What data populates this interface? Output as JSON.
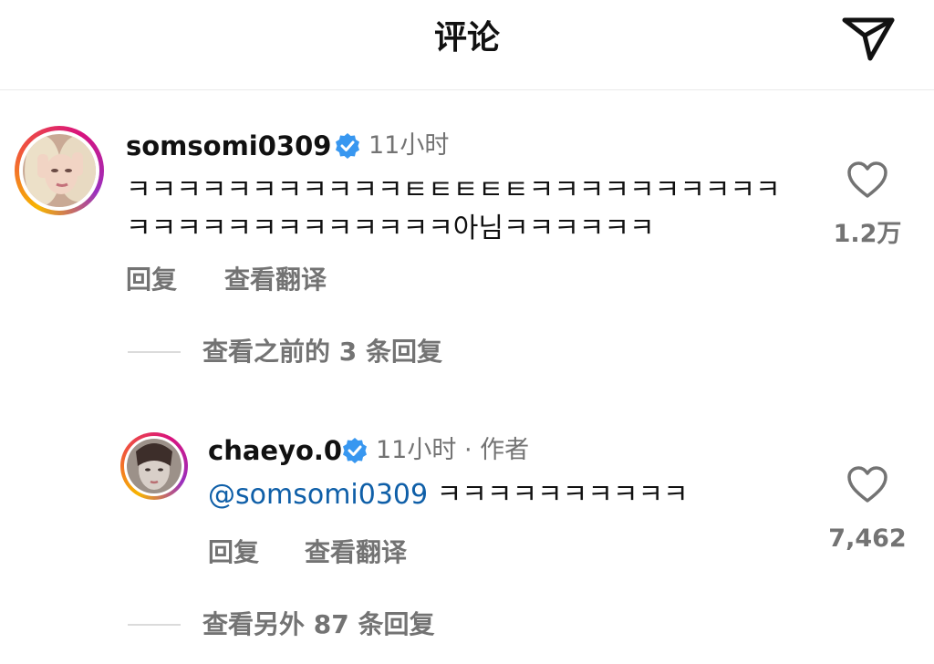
{
  "header": {
    "title": "评论",
    "send_icon": "paper-plane-icon"
  },
  "comments": [
    {
      "username": "somsomi0309",
      "verified": true,
      "time": "11小时",
      "text_lines": [
        "ㅋㅋㅋㅋㅋㅋㅋㅋㅋㅋㅋㅌㅌㅌㅌㅌㅋㅋㅋㅋㅋㅋㅋㅋㅋㅋ",
        "ㅋㅋㅋㅋㅋㅋㅋㅋㅋㅋㅋㅋㅋ아님ㅋㅋㅋㅋㅋㅋ"
      ],
      "reply_label": "回复",
      "translate_label": "查看翻译",
      "likes": "1.2万",
      "view_previous": "查看之前的 3 条回复"
    },
    {
      "username": "chaeyo.0",
      "verified": true,
      "time": "11小时 · 作者",
      "mention": "@somsomi0309",
      "text": " ㅋㅋㅋㅋㅋㅋㅋㅋㅋㅋ",
      "reply_label": "回复",
      "translate_label": "查看翻译",
      "likes": "7,462",
      "view_more": "查看另外 87 条回复"
    }
  ],
  "colors": {
    "text": "#111111",
    "muted": "#737373",
    "link": "#0f5fa8",
    "verified": "#3897f0"
  }
}
